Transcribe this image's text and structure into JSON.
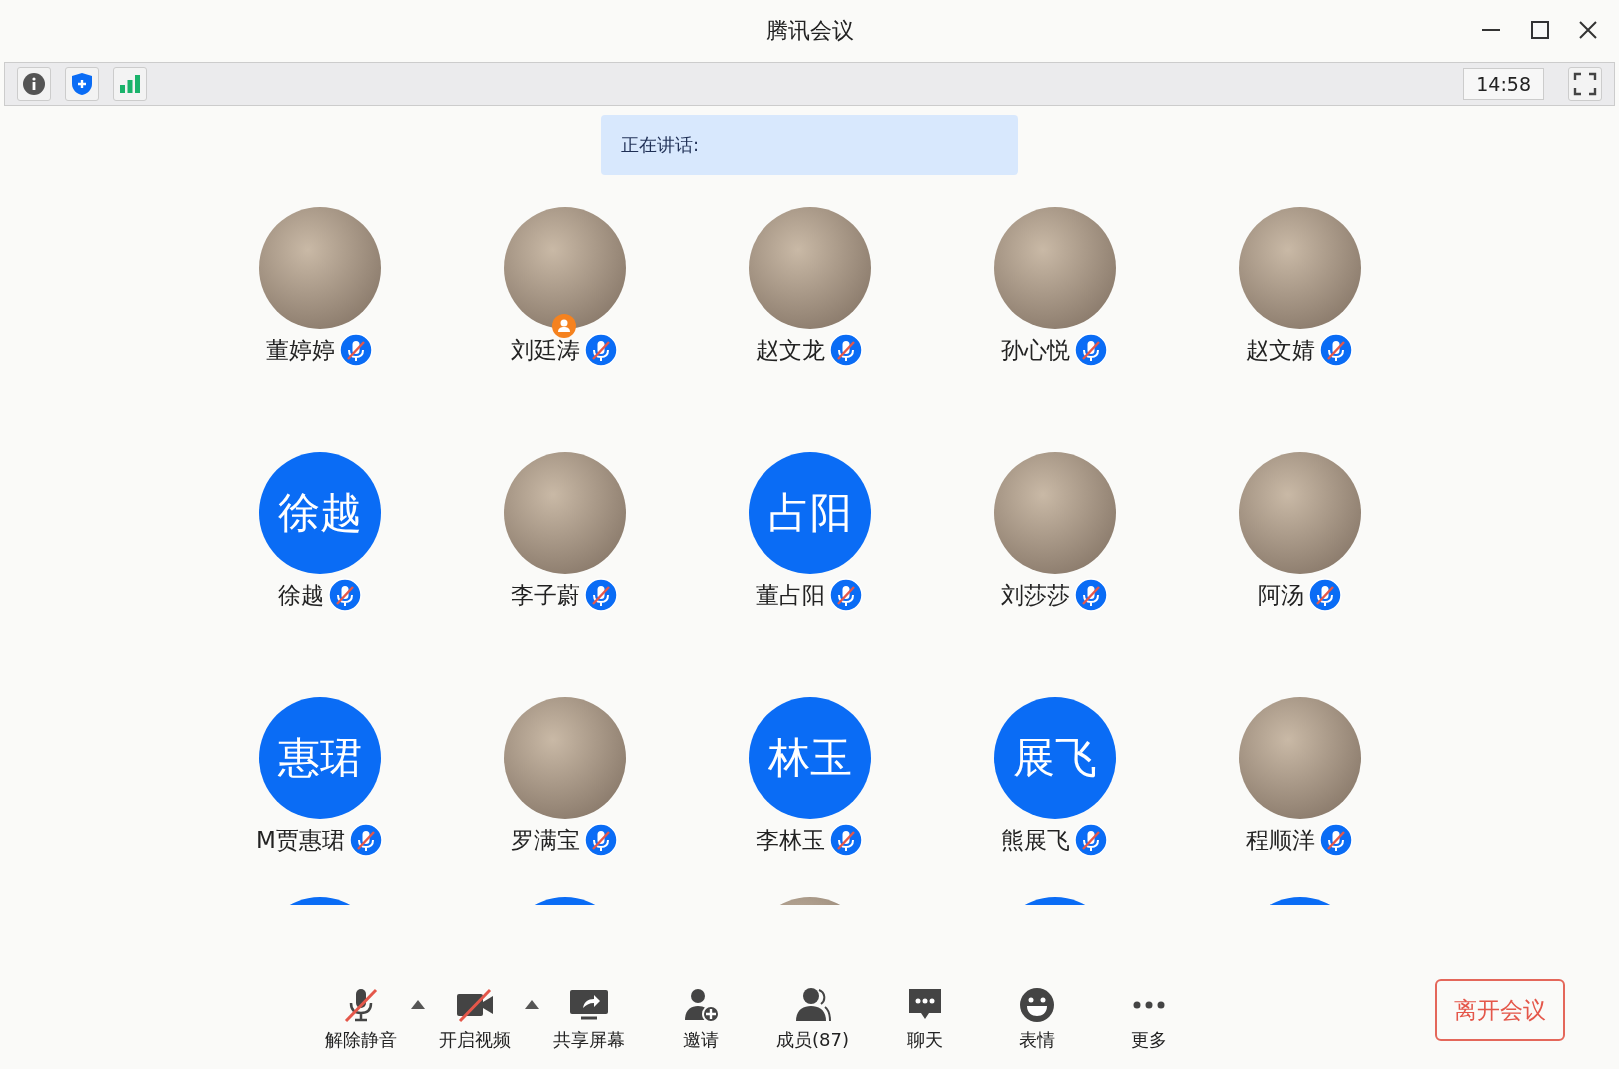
{
  "window": {
    "title": "腾讯会议"
  },
  "info_bar": {
    "time": "14:58"
  },
  "speaking": {
    "label": "正在讲话:"
  },
  "participants": [
    {
      "name": "董婷婷",
      "kind": "photo",
      "muted": true,
      "host": false
    },
    {
      "name": "刘廷涛",
      "kind": "photo",
      "muted": true,
      "host": true
    },
    {
      "name": "赵文龙",
      "kind": "photo",
      "muted": true,
      "host": false
    },
    {
      "name": "孙心悦",
      "kind": "photo",
      "muted": true,
      "host": false
    },
    {
      "name": "赵文婧",
      "kind": "photo",
      "muted": true,
      "host": false
    },
    {
      "name": "徐越",
      "kind": "initials",
      "initials": "徐越",
      "muted": true,
      "host": false
    },
    {
      "name": "李子蔚",
      "kind": "photo",
      "muted": true,
      "host": false
    },
    {
      "name": "董占阳",
      "kind": "initials",
      "initials": "占阳",
      "muted": true,
      "host": false
    },
    {
      "name": "刘莎莎",
      "kind": "photo",
      "muted": true,
      "host": false
    },
    {
      "name": "阿汤",
      "kind": "photo",
      "muted": true,
      "host": false
    },
    {
      "name": "M贾惠珺",
      "kind": "initials",
      "initials": "惠珺",
      "muted": true,
      "host": false
    },
    {
      "name": "罗满宝",
      "kind": "photo",
      "muted": true,
      "host": false
    },
    {
      "name": "李林玉",
      "kind": "initials",
      "initials": "林玉",
      "muted": true,
      "host": false
    },
    {
      "name": "熊展飞",
      "kind": "initials",
      "initials": "展飞",
      "muted": true,
      "host": false
    },
    {
      "name": "程顺洋",
      "kind": "photo",
      "muted": true,
      "host": false
    }
  ],
  "partial_row": [
    {
      "kind": "initials"
    },
    {
      "kind": "initials"
    },
    {
      "kind": "photo"
    },
    {
      "kind": "initials"
    },
    {
      "kind": "initials"
    }
  ],
  "toolbar": [
    {
      "kind": "mic",
      "label": "解除静音",
      "slashed": true,
      "caret": true
    },
    {
      "kind": "video",
      "label": "开启视频",
      "slashed": true,
      "caret": true
    },
    {
      "kind": "share",
      "label": "共享屏幕",
      "slashed": false,
      "caret": false
    },
    {
      "kind": "invite",
      "label": "邀请",
      "slashed": false,
      "caret": false
    },
    {
      "kind": "members",
      "label": "成员(87)",
      "slashed": false,
      "caret": false
    },
    {
      "kind": "chat",
      "label": "聊天",
      "slashed": false,
      "caret": false
    },
    {
      "kind": "emoji",
      "label": "表情",
      "slashed": false,
      "caret": false
    },
    {
      "kind": "more",
      "label": "更多",
      "slashed": false,
      "caret": false
    }
  ],
  "leave_button": {
    "label": "离开会议"
  }
}
